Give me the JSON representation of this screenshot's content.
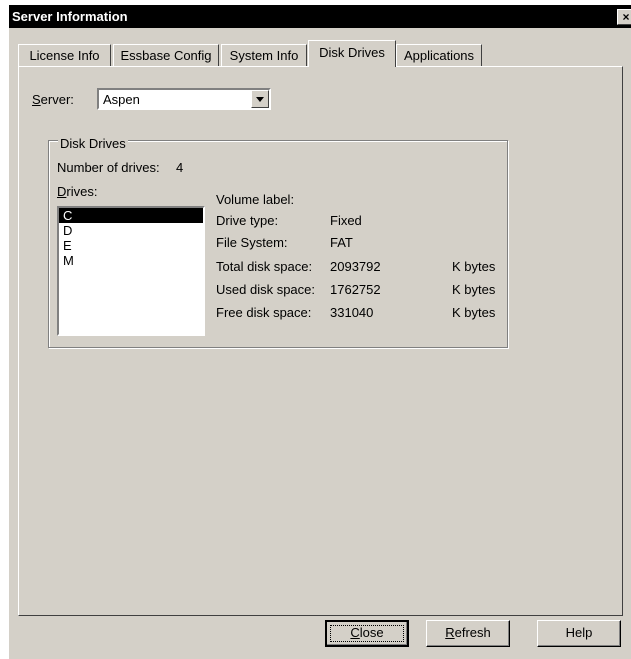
{
  "window": {
    "title": "Server Information",
    "close_glyph": "×"
  },
  "tabs": [
    {
      "label": "License Info"
    },
    {
      "label": "Essbase Config"
    },
    {
      "label": "System Info"
    },
    {
      "label": "Disk Drives",
      "active": true
    },
    {
      "label": "Applications"
    }
  ],
  "server": {
    "label_mnemonic": "S",
    "label_rest": "erver:",
    "value": "Aspen"
  },
  "disk_drives": {
    "group_title": "Disk Drives",
    "number_label": "Number of drives:",
    "number_value": "4",
    "drives_label_mnemonic": "D",
    "drives_label_rest": "rives:",
    "drives": [
      "C",
      "D",
      "E",
      "M"
    ],
    "selected_drive": "C",
    "volume_label": "Volume label:",
    "volume_value": "",
    "drive_type_label": "Drive type:",
    "drive_type_value": "Fixed",
    "file_system_label": "File System:",
    "file_system_value": "FAT",
    "total_label": "Total disk space:",
    "total_value": "2093792",
    "used_label": "Used disk space:",
    "used_value": "1762752",
    "free_label": "Free disk space:",
    "free_value": "331040",
    "unit": "K bytes"
  },
  "buttons": {
    "close_mnemonic": "C",
    "close_rest": "lose",
    "refresh_mnemonic": "R",
    "refresh_rest": "efresh",
    "help": "Help"
  }
}
